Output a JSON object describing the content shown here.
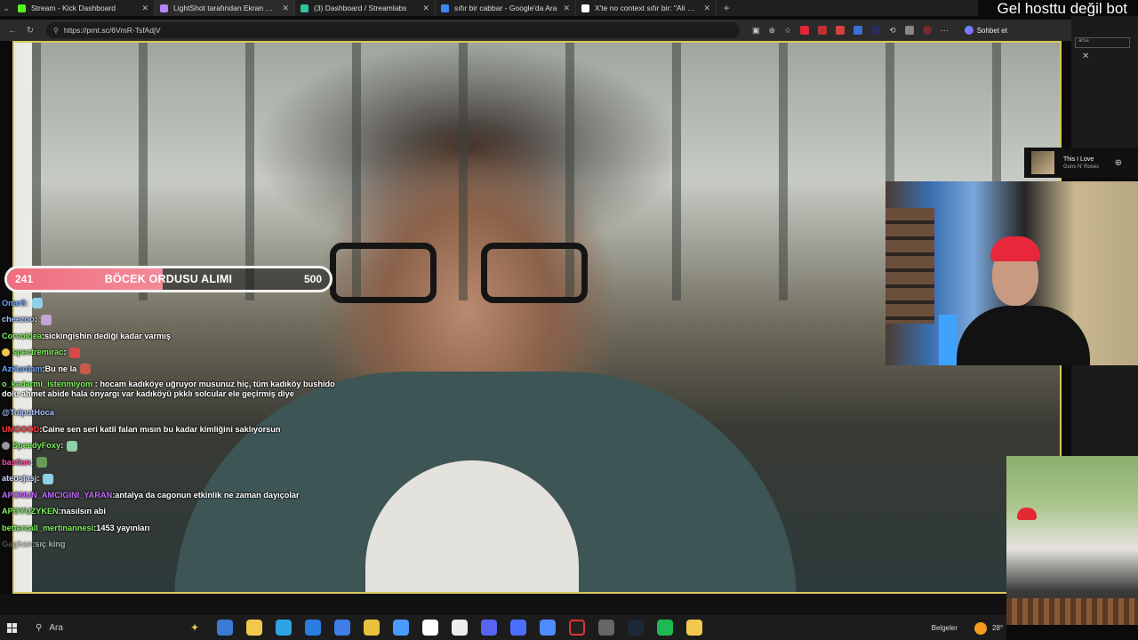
{
  "browser": {
    "tabs": [
      {
        "label": "Stream - Kick Dashboard",
        "color": "#53fc18",
        "active": false
      },
      {
        "label": "LightShot tarafından Ekran Görünt",
        "color": "#b784ff",
        "active": true
      },
      {
        "label": "(3) Dashboard / Streamlabs",
        "color": "#31c3a2",
        "active": false
      },
      {
        "label": "sıfır bir cabbar - Google'da Ara",
        "color": "#4285f4",
        "active": false
      },
      {
        "label": "X'te no context sıfır bir: \"Ali cabba",
        "color": "#ffffff",
        "active": false
      }
    ],
    "url": "https://prnt.sc/6VmR-TsfAdjV",
    "copilot_label": "Sohbet et"
  },
  "overlay": {
    "title": "Gel hosttu değil bot"
  },
  "poll": {
    "left_value": "241",
    "title": "BÖCEK ORDUSU ALIMI",
    "right_value": "500",
    "progress_fraction": 0.482,
    "fill_color": "#f06d7d"
  },
  "chat": [
    {
      "user": "Onar3",
      "sep": " :",
      "text": "",
      "color": "#69a7ff",
      "emote": "#8fd0e8"
    },
    {
      "user": "cheezoo",
      "sep": " :",
      "text": "",
      "color": "#a6c2ff",
      "emote": "#c8a3d9"
    },
    {
      "user": "Corvoidea",
      "sep": " :",
      "text": " sickingishin dediği kadar varmış",
      "color": "#7cf05c",
      "emote": ""
    },
    {
      "user": "spectremirac",
      "sep": " :",
      "text": "",
      "color": "#7cf05c",
      "emote": "#d84a4a",
      "badge": "#f2c94c"
    },
    {
      "user": "AzKardam",
      "sep": " :",
      "text": " Bu ne la",
      "color": "#69a7ff",
      "emote": "#c45a4a"
    },
    {
      "user": "o_kadarmi_istenmiyom",
      "sep": " :",
      "text": " hocam kadıköye uğruyor musunuz hiç, tüm kadıköy bushido dolu ahmet abide hala önyargı var kadıköyü pkklı solcular ele geçirmiş diye",
      "color": "#7cf05c",
      "emote": "",
      "wrap": true
    },
    {
      "user": "@TulputHoca",
      "sep": "",
      "text": "",
      "color": "#a6c2ff",
      "emote": ""
    },
    {
      "user": "UMOOOD",
      "sep": " :",
      "text": " Caine sen seri katil falan mısın bu kadar kimliğini saklıyorsun",
      "color": "#ff3b3b",
      "emote": ""
    },
    {
      "user": "SpeedyFoxy",
      "sep": " :",
      "text": "",
      "color": "#7cf05c",
      "emote": "#8fd0a8",
      "badge": "#9a9a9a"
    },
    {
      "user": "bastlan",
      "sep": " :",
      "text": "",
      "color": "#ff4fa8",
      "emote": "#6a9a5a"
    },
    {
      "user": "ateosjasj",
      "sep": " :",
      "text": "",
      "color": "#cfd6ff",
      "emote": "#8fd0e8"
    },
    {
      "user": "APONUN_AMCIGINI_YARAN",
      "sep": " :",
      "text": " antalya da cagonun etkinlik ne zaman dayıçolar",
      "color": "#c46bff",
      "emote": ""
    },
    {
      "user": "APOYUZYKEN",
      "sep": " :",
      "text": " nasılsın abi",
      "color": "#7cf05c",
      "emote": ""
    },
    {
      "user": "bettercall_mertinannesi",
      "sep": " :",
      "text": " 1453 yayınları",
      "color": "#7cf05c",
      "emote": ""
    },
    {
      "user": "Gaghan",
      "sep": " :",
      "text": " sıç king",
      "color": "#8a8a8a",
      "emote": "",
      "faded": true
    }
  ],
  "music": {
    "song": "This I Love",
    "artist": "Guns N' Roses"
  },
  "taskbar": {
    "search_placeholder": "Ara",
    "tray_label": "Belgeler",
    "temperature": "28°",
    "icons": [
      "widgets-icon",
      "file-explorer-icon",
      "edge-icon",
      "mail-icon",
      "store-icon",
      "app-icon",
      "app-icon",
      "notes-icon",
      "app-icon",
      "discord-icon",
      "app-icon",
      "vpn-icon",
      "obs-icon",
      "media-icon",
      "steam-icon",
      "spotify-icon",
      "folder-icon"
    ],
    "icon_colors": [
      "#3a7bd5",
      "#f2c94c",
      "#2fa3e6",
      "#2a7de1",
      "#3f7de8",
      "#e8c23a",
      "#4b9bff",
      "#ffffff",
      "#eeeeee",
      "#5865f2",
      "#4c6fff",
      "#4e8cff",
      "#222222",
      "#666666",
      "#1b2838",
      "#1db954",
      "#f2c94c"
    ]
  }
}
